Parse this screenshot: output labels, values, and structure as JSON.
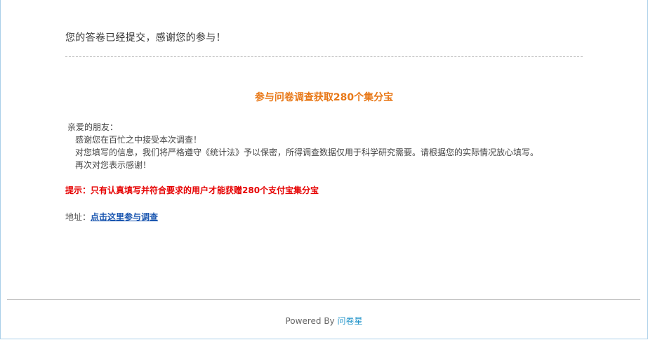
{
  "submission": {
    "message": "您的答卷已经提交，感谢您的参与！"
  },
  "promo": {
    "title": "参与问卷调查获取280个集分宝"
  },
  "letter": {
    "greeting": "亲爱的朋友：",
    "line1": "感谢您在百忙之中接受本次调查！",
    "line2": "对您填写的信息，我们将严格遵守《统计法》予以保密，所得调查数据仅用于科学研究需要。请根据您的实际情况放心填写。",
    "line3": "再次对您表示感谢！"
  },
  "notice": {
    "text": "提示：只有认真填写并符合要求的用户才能获赠280个支付宝集分宝"
  },
  "address": {
    "label": "地址：",
    "link_text": "点击这里参与调查"
  },
  "footer": {
    "powered_by": "Powered By",
    "brand": "问卷星"
  },
  "colors": {
    "promo_title": "#e87817",
    "notice": "#e60000",
    "link": "#1a56b0",
    "brand": "#1f93c9",
    "frame_border": "#a9cfe9"
  }
}
